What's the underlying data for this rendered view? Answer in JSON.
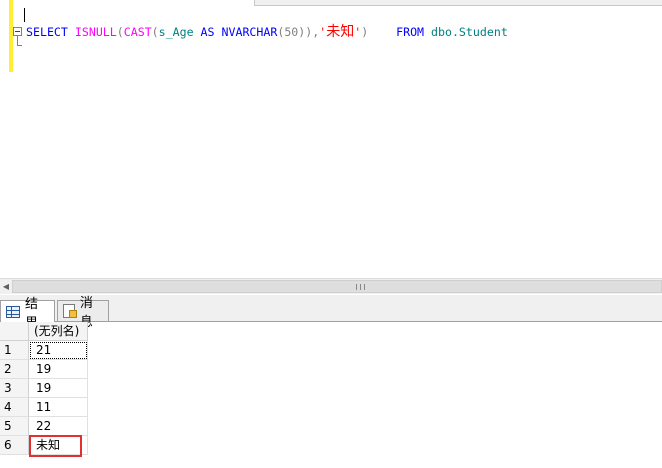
{
  "editor": {
    "code_tokens": {
      "select": "SELECT",
      "isnull": "ISNULL",
      "open1": "(",
      "cast": "CAST",
      "open2": "(",
      "column": "s_Age",
      "as": "AS",
      "nvarchar": "NVARCHAR",
      "len": "(50)",
      "close": "),",
      "quote_open": "'",
      "literal": "未知",
      "quote_close": "'",
      "close_paren": ")",
      "from": "FROM",
      "table": "dbo.Student"
    }
  },
  "tabs": {
    "results_label": "结果",
    "messages_label": "消息",
    "results_icon": "grid-icon",
    "messages_icon": "message-icon"
  },
  "grid": {
    "column_header": "(无列名)",
    "rows": [
      {
        "num": "1",
        "value": "21"
      },
      {
        "num": "2",
        "value": "19"
      },
      {
        "num": "3",
        "value": "19"
      },
      {
        "num": "4",
        "value": "11"
      },
      {
        "num": "5",
        "value": "22"
      },
      {
        "num": "6",
        "value": "未知"
      }
    ]
  },
  "colors": {
    "keyword": "#0000ff",
    "function": "#ff00ff",
    "string": "#ff0000",
    "identifier": "#008080",
    "highlight_box": "#e03030"
  }
}
